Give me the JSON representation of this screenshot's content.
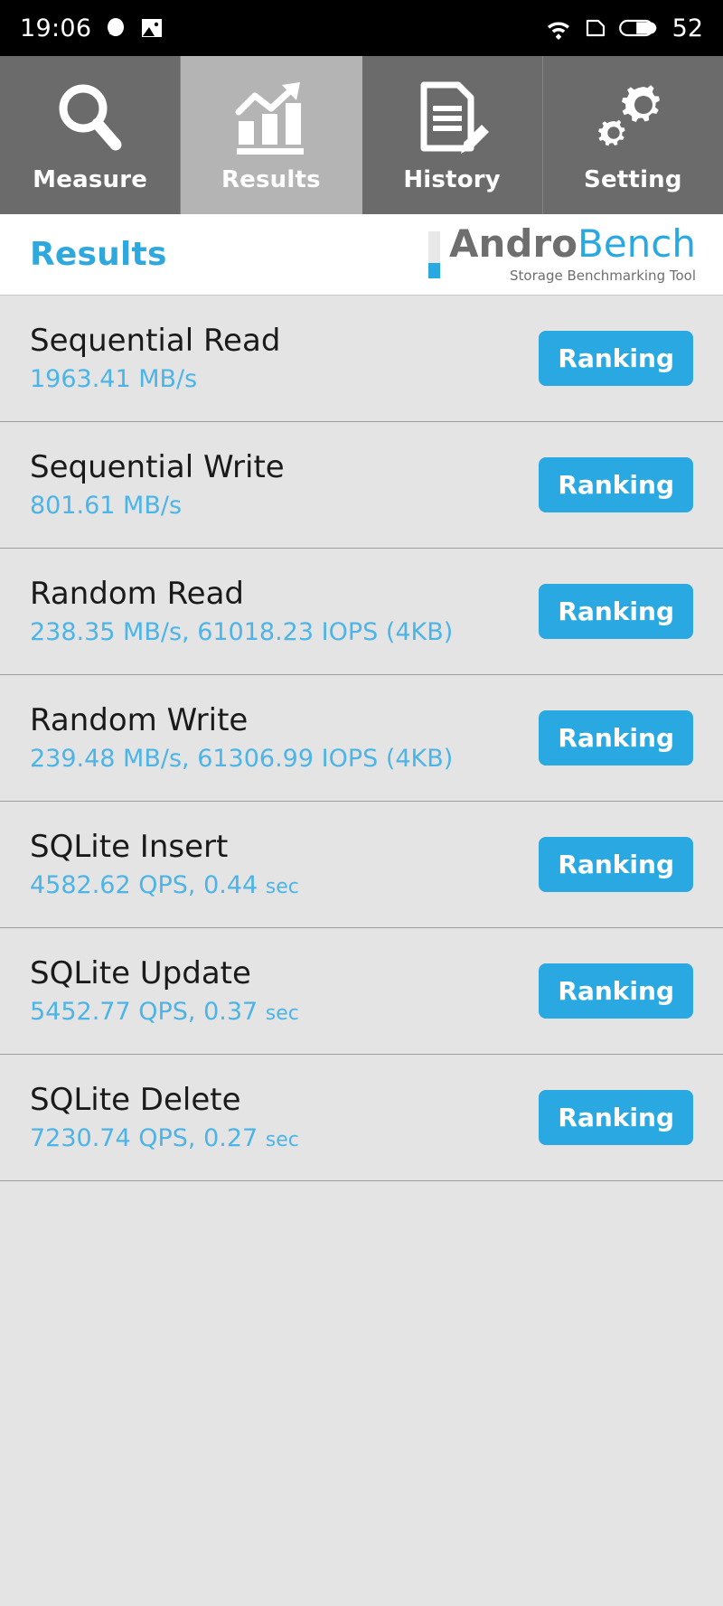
{
  "status_bar": {
    "time": "19:06",
    "battery_level": "52",
    "icons": [
      "notification-dot-icon",
      "screenshot-icon",
      "wifi-icon",
      "sim-card-icon",
      "battery-icon"
    ]
  },
  "tabs": [
    {
      "label": "Measure",
      "icon": "magnifier-icon",
      "active": false
    },
    {
      "label": "Results",
      "icon": "bar-chart-arrow-icon",
      "active": true
    },
    {
      "label": "History",
      "icon": "document-pencil-icon",
      "active": false
    },
    {
      "label": "Setting",
      "icon": "gears-icon",
      "active": false
    }
  ],
  "header": {
    "title": "Results",
    "logo_primary": "Andro",
    "logo_secondary": "Bench",
    "logo_subtitle": "Storage Benchmarking Tool"
  },
  "results": [
    {
      "title": "Sequential Read",
      "value": "1963.41 MB/s",
      "unit_suffix": "",
      "button": "Ranking"
    },
    {
      "title": "Sequential Write",
      "value": "801.61 MB/s",
      "unit_suffix": "",
      "button": "Ranking"
    },
    {
      "title": "Random Read",
      "value": "238.35 MB/s, 61018.23 IOPS (4KB)",
      "unit_suffix": "",
      "button": "Ranking"
    },
    {
      "title": "Random Write",
      "value": "239.48 MB/s, 61306.99 IOPS (4KB)",
      "unit_suffix": "",
      "button": "Ranking"
    },
    {
      "title": "SQLite Insert",
      "value": "4582.62 QPS, 0.44",
      "unit_suffix": "sec",
      "button": "Ranking"
    },
    {
      "title": "SQLite Update",
      "value": "5452.77 QPS, 0.37",
      "unit_suffix": "sec",
      "button": "Ranking"
    },
    {
      "title": "SQLite Delete",
      "value": "7230.74 QPS, 0.27",
      "unit_suffix": "sec",
      "button": "Ranking"
    }
  ],
  "colors": {
    "accent_blue": "#2aa8e2",
    "value_blue": "#4cb4e7",
    "tab_inactive": "#6b6b6b",
    "tab_active": "#b4b4b4",
    "list_bg": "#e4e4e4"
  }
}
